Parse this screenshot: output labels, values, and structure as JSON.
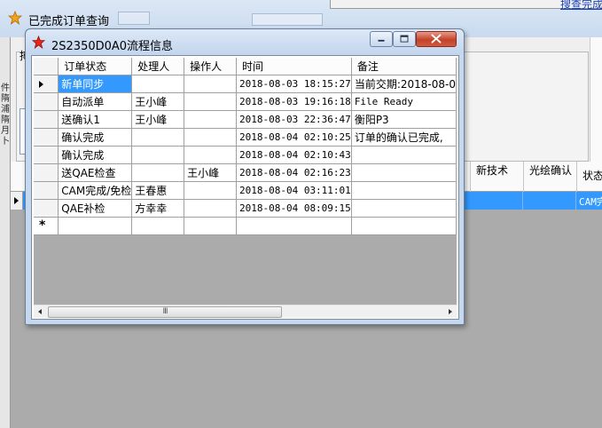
{
  "parent_window": {
    "title": "已完成订单查询",
    "top_link": "搜查完成",
    "label_partial": "搏",
    "left_edge_glyphs": [
      "件",
      "隋",
      "浦",
      "隋",
      "月",
      "卜"
    ],
    "grid_headers": [
      "新技术",
      "光绘确认",
      "状态"
    ],
    "row_status": "CAM完"
  },
  "dialog": {
    "title": "2S2350D0A0流程信息",
    "columns": [
      "订单状态",
      "处理人",
      "操作人",
      "时间",
      "备注"
    ],
    "rows": [
      {
        "status": "新单同步",
        "handler": "",
        "operator": "",
        "time": "2018-08-03 18:15:27",
        "note": "当前交期:2018-08-0",
        "selected": true
      },
      {
        "status": "自动派单",
        "handler": "王小峰",
        "operator": "",
        "time": "2018-08-03 19:16:18",
        "note": "File Ready"
      },
      {
        "status": "送确认1",
        "handler": "王小峰",
        "operator": "",
        "time": "2018-08-03 22:36:47",
        "note": "衡阳P3"
      },
      {
        "status": "确认完成",
        "handler": "",
        "operator": "",
        "time": "2018-08-04 02:10:25",
        "note": "订单的确认已完成,"
      },
      {
        "status": "确认完成",
        "handler": "",
        "operator": "",
        "time": "2018-08-04 02:10:43",
        "note": ""
      },
      {
        "status": "送QAE检查",
        "handler": "",
        "operator": "王小峰",
        "time": "2018-08-04 02:16:23",
        "note": ""
      },
      {
        "status": "CAM完成/免检",
        "handler": "王春惠",
        "operator": "",
        "time": "2018-08-04 03:11:01",
        "note": ""
      },
      {
        "status": "QAE补检",
        "handler": "方幸幸",
        "operator": "",
        "time": "2018-08-04 08:09:15",
        "note": ""
      }
    ],
    "new_row_marker": "*",
    "scroll_thumb_glyph": "III"
  },
  "colors": {
    "selection": "#3399ff",
    "titlebar": "#c9daef",
    "grid_background": "#ababab",
    "close_button": "#c3432a"
  },
  "icons": {
    "parent_title": "star-icon",
    "dialog_title": "star-icon",
    "minimize": "minimize-icon",
    "maximize": "maximize-icon",
    "close": "close-icon"
  }
}
